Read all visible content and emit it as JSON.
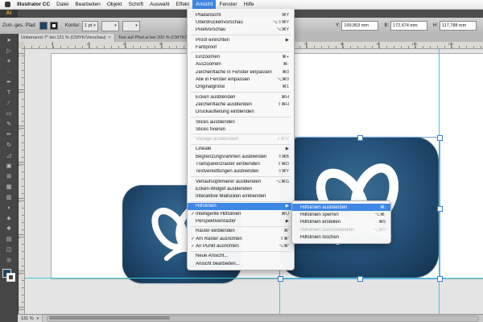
{
  "menubar": {
    "items": [
      {
        "label": "Illustrator CC",
        "bold": true
      },
      {
        "label": "Datei"
      },
      {
        "label": "Bearbeiten"
      },
      {
        "label": "Objekt"
      },
      {
        "label": "Schrift"
      },
      {
        "label": "Auswahl"
      },
      {
        "label": "Effekt"
      },
      {
        "label": "Ansicht",
        "active": true
      },
      {
        "label": "Fenster"
      },
      {
        "label": "Hilfe"
      }
    ]
  },
  "app_bar": {
    "logo": "Ai"
  },
  "control_panel": {
    "selection_label": "Zsm.-ges. Pfad",
    "stroke_label": "Kontur:",
    "stroke_value": "1 pt",
    "fields": [
      {
        "label": "Y:",
        "value": "199,953 mm"
      },
      {
        "label": "B:",
        "value": "172,674 mm"
      },
      {
        "label": "H:",
        "value": "117,788 mm"
      }
    ]
  },
  "tabs": [
    {
      "title": "Unbenannt-7* bei 131 % (CMYK/Vorschau)",
      "close": "×",
      "active": true
    },
    {
      "title": "Test auf Pfad.ai bei 200 % (CMYK/Vorschau)",
      "close": "×",
      "active": false
    }
  ],
  "rulers": {
    "h_labels": [
      "0",
      "10",
      "20",
      "30",
      "40",
      "50",
      "60",
      "70",
      "80",
      "90",
      "100",
      "110"
    ],
    "v_labels": [
      "0",
      "10",
      "20",
      "30",
      "40",
      "50",
      "60",
      "70"
    ]
  },
  "tools": [
    {
      "name": "selection",
      "glyph": "➤"
    },
    {
      "name": "direct-selection",
      "glyph": "▷"
    },
    {
      "name": "magic-wand",
      "glyph": "✶"
    },
    {
      "name": "lasso",
      "glyph": "◌"
    },
    {
      "name": "pen",
      "glyph": "✒"
    },
    {
      "name": "type",
      "glyph": "T"
    },
    {
      "name": "line-segment",
      "glyph": "∕"
    },
    {
      "name": "rectangle",
      "glyph": "▭"
    },
    {
      "name": "paintbrush",
      "glyph": "✎"
    },
    {
      "name": "pencil",
      "glyph": "✏"
    },
    {
      "name": "rotate",
      "glyph": "↻"
    },
    {
      "name": "scale",
      "glyph": "◿"
    },
    {
      "name": "free-transform",
      "glyph": "▣"
    },
    {
      "name": "perspective-grid",
      "glyph": "⊞"
    },
    {
      "name": "mesh",
      "glyph": "▦"
    },
    {
      "name": "gradient",
      "glyph": "▥"
    },
    {
      "name": "eyedropper",
      "glyph": "◗"
    },
    {
      "name": "blend",
      "glyph": "◈"
    },
    {
      "name": "symbol-sprayer",
      "glyph": "❖"
    },
    {
      "name": "graph",
      "glyph": "▤"
    },
    {
      "name": "artboard",
      "glyph": "◫"
    },
    {
      "name": "zoom",
      "glyph": "◎"
    }
  ],
  "view_menu": {
    "title": "Ansicht",
    "groups": [
      [
        {
          "label": "Pfadansicht",
          "shortcut": "⌘Y"
        },
        {
          "label": "Überdruckenvorschau",
          "shortcut": "⌥⇧⌘Y"
        },
        {
          "label": "Pixelvorschau",
          "shortcut": "⌥⌘Y"
        }
      ],
      [
        {
          "label": "Proof einrichten",
          "submenu": true
        },
        {
          "label": "Farbproof"
        }
      ],
      [
        {
          "label": "Einzoomen",
          "shortcut": "⌘+"
        },
        {
          "label": "Auszoomen",
          "shortcut": "⌘-"
        },
        {
          "label": "Zeichenfläche in Fenster einpassen",
          "shortcut": "⌘0"
        },
        {
          "label": "Alle in Fenster einpassen",
          "shortcut": "⌥⌘0"
        },
        {
          "label": "Originalgröße",
          "shortcut": "⌘1"
        }
      ],
      [
        {
          "label": "Ecken ausblenden",
          "shortcut": "⌘H"
        },
        {
          "label": "Zeichenfläche ausblenden",
          "shortcut": "⇧⌘H"
        },
        {
          "label": "Druckaufteilung einblenden"
        }
      ],
      [
        {
          "label": "Slices ausblenden"
        },
        {
          "label": "Slices fixieren"
        }
      ],
      [
        {
          "label": "Vorlage ausblenden",
          "shortcut": "⇧⌘W",
          "disabled": true
        }
      ],
      [
        {
          "label": "Lineale",
          "submenu": true
        },
        {
          "label": "Begrenzungsrahmen ausblenden",
          "shortcut": "⇧⌘B"
        },
        {
          "label": "Transparenzraster einblenden",
          "shortcut": "⇧⌘D"
        },
        {
          "label": "Textverkettungen ausblenden",
          "shortcut": "⇧⌘Y"
        }
      ],
      [
        {
          "label": "Verlaufsoptimierer ausblenden",
          "shortcut": "⌥⌘G"
        },
        {
          "label": "Ecken-Widget ausblenden"
        },
        {
          "label": "Interaktive Mallücken einblenden"
        }
      ],
      [
        {
          "label": "Hilfslinien",
          "submenu": true,
          "highlight": true
        },
        {
          "label": "Intelligente Hilfslinien",
          "shortcut": "⌘U",
          "checked": true
        },
        {
          "label": "Perspektivenraster",
          "submenu": true
        }
      ],
      [
        {
          "label": "Raster einblenden",
          "shortcut": "⌘'"
        },
        {
          "label": "Am Raster ausrichten",
          "shortcut": "⇧⌘'",
          "checked": true
        },
        {
          "label": "An Punkt ausrichten",
          "shortcut": "⌥⌘'",
          "checked": true
        }
      ],
      [
        {
          "label": "Neue Ansicht..."
        },
        {
          "label": "Ansicht bearbeiten..."
        }
      ]
    ]
  },
  "guides_submenu": {
    "items": [
      {
        "label": "Hilfslinien ausblenden",
        "shortcut": "⌘;",
        "highlight": true
      },
      {
        "label": "Hilfslinien sperren",
        "shortcut": "⌥⌘;"
      },
      {
        "label": "Hilfslinien erstellen",
        "shortcut": "⌘5"
      },
      {
        "label": "Hilfslinien zurückwandeln",
        "shortcut": "⌥⌘5",
        "disabled": true
      },
      {
        "label": "Hilfslinien löschen"
      }
    ]
  },
  "status_bar": {
    "zoom": "131 %"
  },
  "icons": {
    "submenu_arrow": "▶",
    "check": "✓",
    "dropdown_arrow": "▾",
    "close": "×"
  },
  "colors": {
    "menu_highlight": "#3f87e5",
    "guide": "#3fc6df",
    "selection": "#3a7bd5",
    "icon_bg_center": "#3c7094",
    "icon_bg_edge": "#12314d",
    "ai_logo": "#e8a33d"
  }
}
